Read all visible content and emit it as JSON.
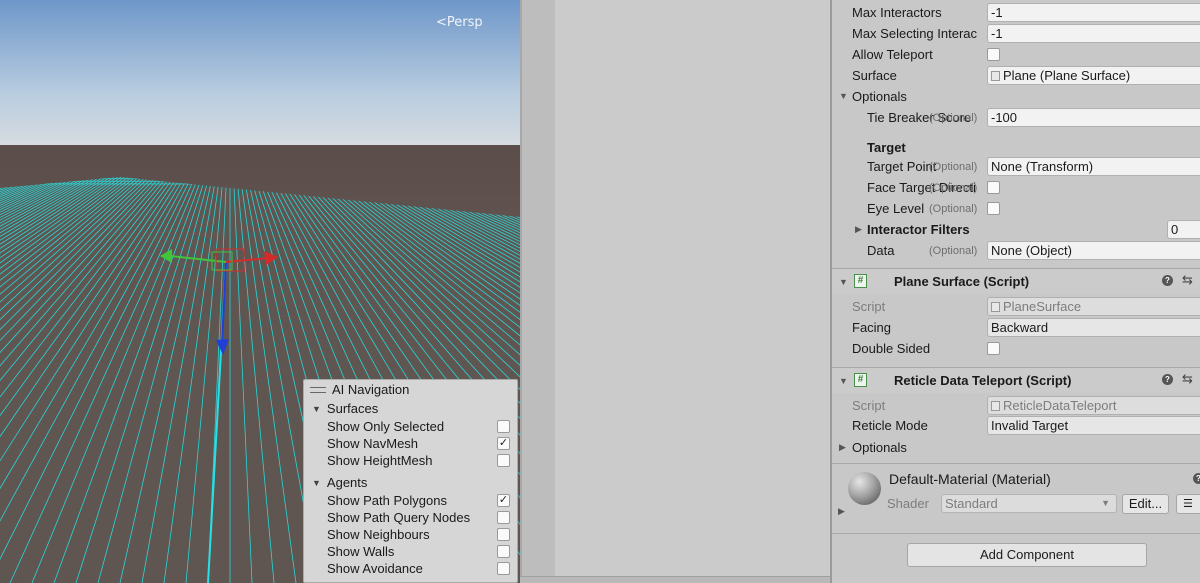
{
  "scene": {
    "camera_label": "Persp",
    "ai_navigation": {
      "title": "AI Navigation",
      "sections": [
        {
          "name": "Surfaces",
          "items": [
            {
              "label": "Show Only Selected",
              "checked": false
            },
            {
              "label": "Show NavMesh",
              "checked": true
            },
            {
              "label": "Show HeightMesh",
              "checked": false
            }
          ]
        },
        {
          "name": "Agents",
          "items": [
            {
              "label": "Show Path Polygons",
              "checked": true
            },
            {
              "label": "Show Path Query Nodes",
              "checked": false
            },
            {
              "label": "Show Neighbours",
              "checked": false
            },
            {
              "label": "Show Walls",
              "checked": false
            },
            {
              "label": "Show Avoidance",
              "checked": false
            }
          ]
        }
      ]
    }
  },
  "inspector": {
    "max_interactors": {
      "label": "Max Interactors",
      "value": "-1"
    },
    "max_selecting": {
      "label": "Max Selecting Interac",
      "value": "-1"
    },
    "allow_teleport": {
      "label": "Allow Teleport",
      "checked": false
    },
    "surface": {
      "label": "Surface",
      "value": "Plane (Plane Surface)"
    },
    "optionals_label": "Optionals",
    "tie_breaker": {
      "label": "Tie Breaker Score",
      "optional": "(Optional)",
      "value": "-100"
    },
    "target_header": "Target",
    "target_point": {
      "label": "Target Point",
      "optional": "(Optional)",
      "value": "None (Transform)"
    },
    "face_target": {
      "label": "Face Target Directi",
      "optional": "(Optional)",
      "checked": false
    },
    "eye_level": {
      "label": "Eye Level",
      "optional": "(Optional)",
      "checked": false
    },
    "interactor_filters": {
      "label": "Interactor Filters",
      "count": "0"
    },
    "data_field": {
      "label": "Data",
      "optional": "(Optional)",
      "value": "None (Object)"
    },
    "plane_surface": {
      "title": "Plane Surface (Script)",
      "script_label": "Script",
      "script_value": "PlaneSurface",
      "facing_label": "Facing",
      "facing_value": "Backward",
      "double_sided_label": "Double Sided",
      "double_sided": false
    },
    "reticle": {
      "title": "Reticle Data Teleport (Script)",
      "script_label": "Script",
      "script_value": "ReticleDataTeleport",
      "mode_label": "Reticle Mode",
      "mode_value": "Invalid Target",
      "optionals_label": "Optionals"
    },
    "material": {
      "title": "Default-Material (Material)",
      "shader_label": "Shader",
      "shader_value": "Standard",
      "edit_label": "Edit..."
    },
    "add_component": "Add Component"
  },
  "colors": {
    "grid": "#29d6d6",
    "axis_x": "#d42a2a",
    "axis_y": "#42c43a",
    "axis_z": "#1f3fd6",
    "script_icon": "#3e7f3e"
  }
}
